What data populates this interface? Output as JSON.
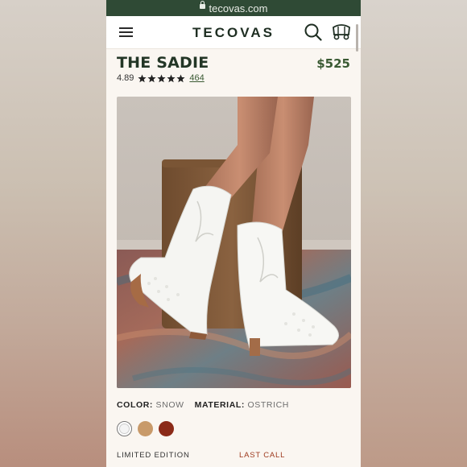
{
  "browser": {
    "url": "tecovas.com"
  },
  "nav": {
    "logo": "TECOVAS"
  },
  "product": {
    "title": "THE SADIE",
    "price": "$525",
    "rating": "4.89",
    "stars": 5,
    "review_count": "464",
    "color_label": "COLOR:",
    "color_value": "SNOW",
    "material_label": "MATERIAL:",
    "material_value": "OSTRICH",
    "swatches": [
      {
        "name": "Snow",
        "color": "#f4f4f4",
        "selected": true
      },
      {
        "name": "Tan",
        "color": "#c89a6a",
        "selected": false
      },
      {
        "name": "Red",
        "color": "#8b2a18",
        "selected": false
      }
    ],
    "section_labels": {
      "limited": "LIMITED EDITION",
      "last_call": "LAST CALL"
    }
  },
  "colors": {
    "brand_green": "#2f4a35",
    "price_green": "#3a5a33",
    "last_call_red": "#9e3a1e"
  }
}
